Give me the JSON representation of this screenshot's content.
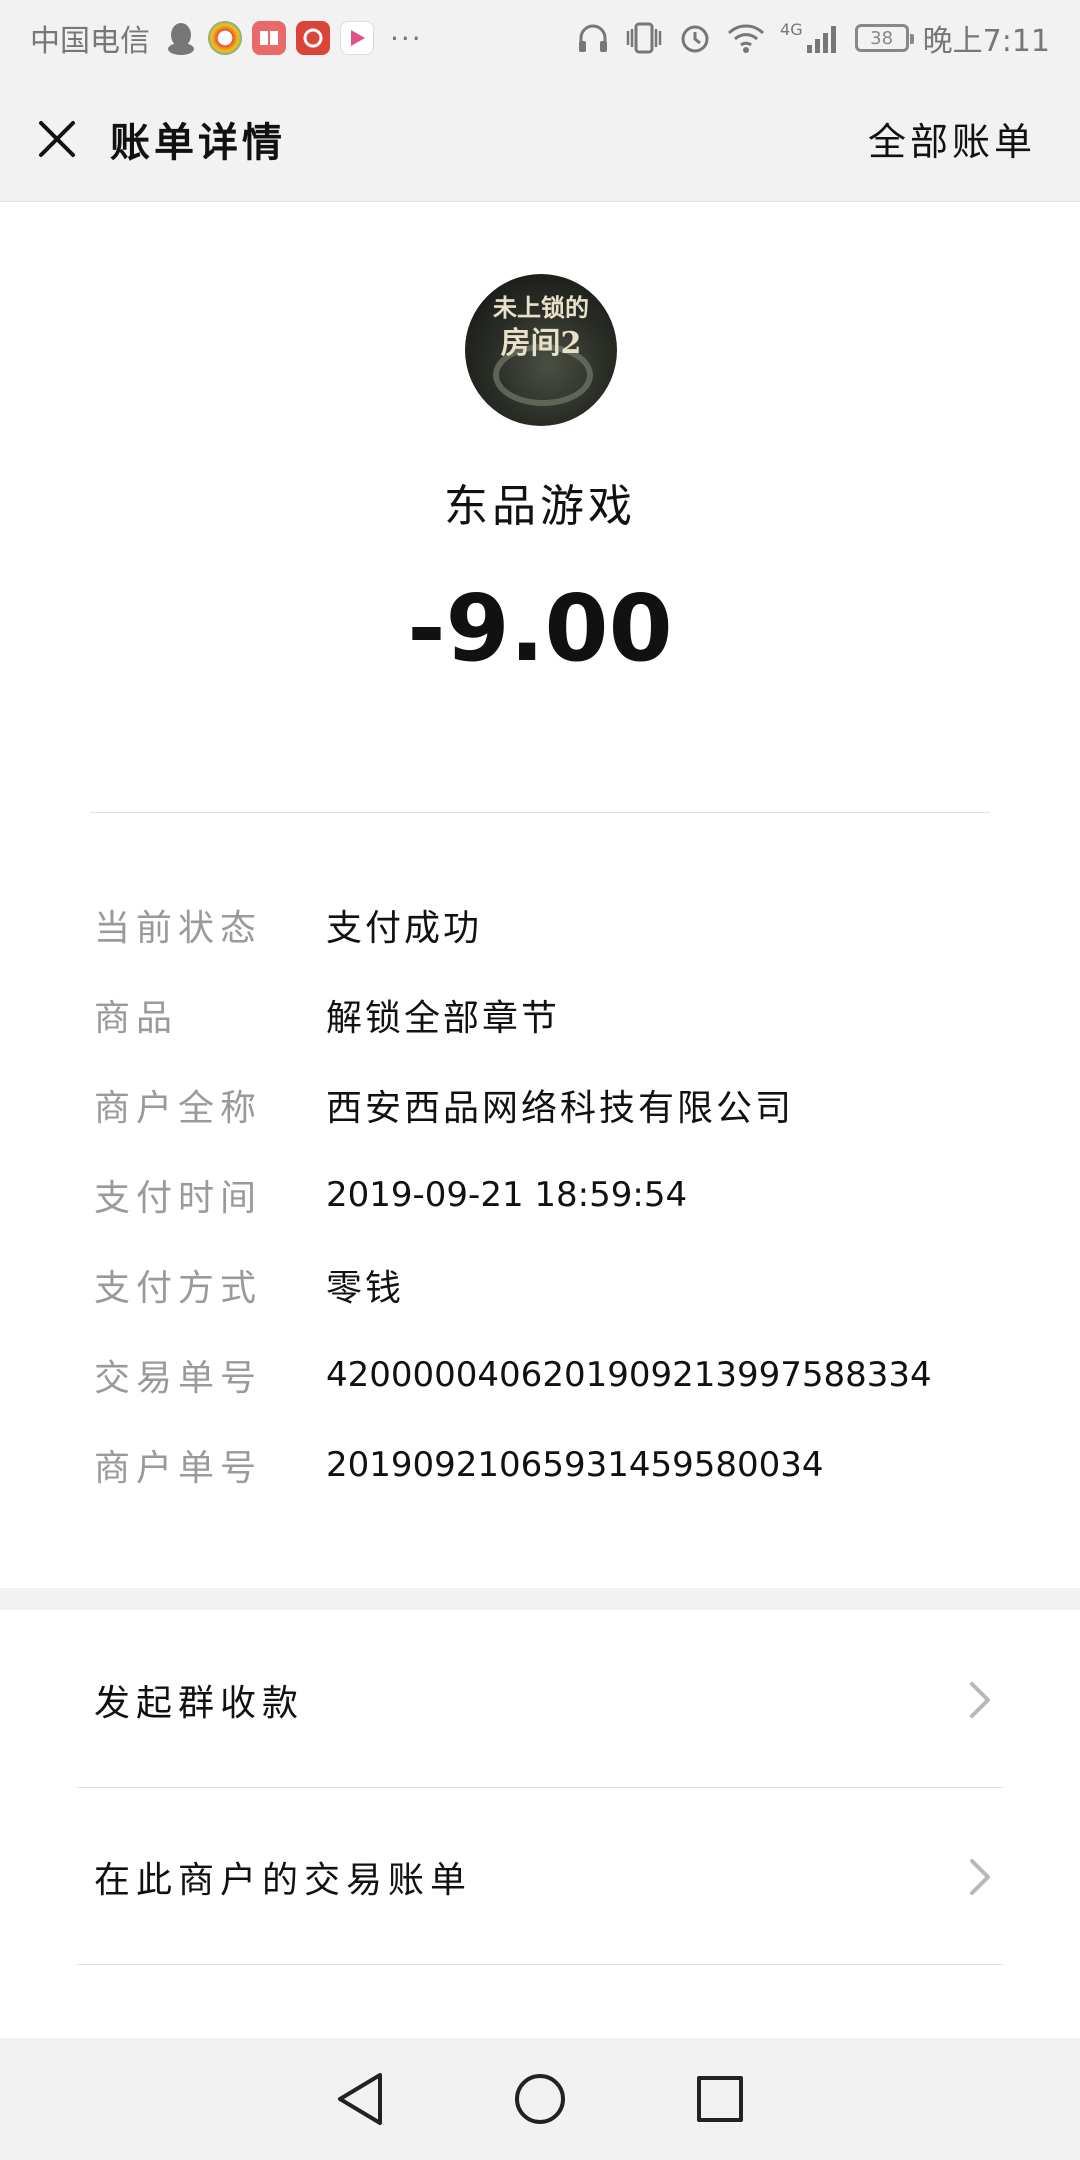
{
  "status_bar": {
    "carrier": "中国电信",
    "more": "···",
    "time": "晚上7:11",
    "battery": "38",
    "network": "4G"
  },
  "header": {
    "title": "账单详情",
    "all_bills_label": "全部账单"
  },
  "summary": {
    "merchant_name": "东品游戏",
    "amount": "-9.00",
    "avatar_text_line1": "未上锁的",
    "avatar_text_line2": "房间2"
  },
  "details": {
    "rows": [
      {
        "label": "当前状态",
        "value": "支付成功"
      },
      {
        "label": "商品",
        "value": "解锁全部章节"
      },
      {
        "label": "商户全称",
        "value": "西安西品网络科技有限公司"
      },
      {
        "label": "支付时间",
        "value": "2019-09-21 18:59:54"
      },
      {
        "label": "支付方式",
        "value": "零钱"
      },
      {
        "label": "交易单号",
        "value": "4200000406201909213997588334"
      },
      {
        "label": "商户单号",
        "value": "20190921065931459580034"
      }
    ]
  },
  "actions": {
    "group_collect": "发起群收款",
    "merchant_bills": "在此商户的交易账单"
  },
  "icons": {
    "close": "close-icon",
    "chevron": "chevron-right-icon",
    "back": "back-triangle-icon",
    "home": "home-circle-icon",
    "recents": "recents-square-icon"
  },
  "colors": {
    "background": "#f2f2f2",
    "label_gray": "#9a9a9a",
    "text": "#111111"
  }
}
